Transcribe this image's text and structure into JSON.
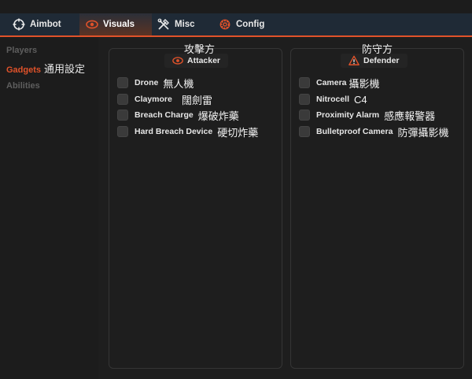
{
  "tabs": [
    {
      "label": "Aimbot",
      "icon": "crosshair-icon"
    },
    {
      "label": "Visuals",
      "icon": "eye-icon"
    },
    {
      "label": "Misc",
      "icon": "tools-icon"
    },
    {
      "label": "Config",
      "icon": "gear-icon"
    }
  ],
  "sidebar": {
    "items": [
      {
        "label": "Players"
      },
      {
        "label": "Gadgets",
        "extra": "通用設定"
      },
      {
        "label": "Abilities"
      }
    ]
  },
  "attacker": {
    "caption": "攻擊方",
    "header": "Attacker",
    "icon": "eye-icon",
    "items": [
      {
        "label": "Drone",
        "tr": "無人機"
      },
      {
        "label": "Claymore",
        "tr": "闊劍雷"
      },
      {
        "label": "Breach Charge",
        "tr": "爆破炸藥"
      },
      {
        "label": "Hard Breach Device",
        "tr": "硬切炸藥"
      }
    ]
  },
  "defender": {
    "caption": "防守方",
    "header": "Defender",
    "icon": "warning-icon",
    "items": [
      {
        "label": "Camera",
        "tr": "攝影機"
      },
      {
        "label": "Nitrocell",
        "tr": "C4"
      },
      {
        "label": "Proximity Alarm",
        "tr": "感應報警器"
      },
      {
        "label": "Bulletproof Camera",
        "tr": "防彈攝影機"
      }
    ]
  },
  "colors": {
    "accent": "#e0522a",
    "topbar": "#1f2a36",
    "background": "#1c1c1c"
  }
}
